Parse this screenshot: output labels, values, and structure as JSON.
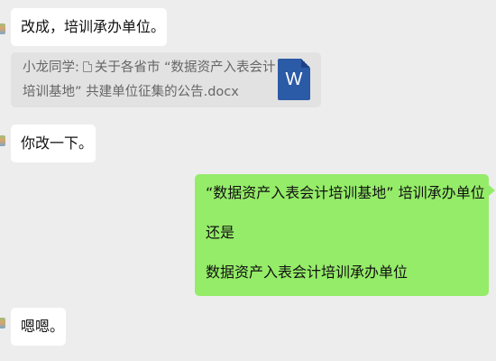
{
  "messages": {
    "m1": {
      "text": "改成，培训承办单位。"
    },
    "quote": {
      "line1_prefix": "小龙同学:",
      "line1_rest": "关于各省市 “数据资产入表会计",
      "line2": "培训基地” 共建单位征集的公告.docx",
      "file_icon_letter": "W",
      "file_icon": "word-doc-icon"
    },
    "m2": {
      "text": "你改一下。"
    },
    "m3": {
      "line1": "“数据资产入表会计培训基地” 培训承办单位",
      "line2": "还是",
      "line3": "数据资产入表会计培训承办单位"
    },
    "m4": {
      "text": "嗯嗯。"
    }
  },
  "colors": {
    "chat_bg": "#ededed",
    "incoming_bubble": "#ffffff",
    "outgoing_bubble": "#95ec69",
    "quote_bg": "#e2e2e2",
    "quote_text": "#666666",
    "word_blue": "#2b5aa6"
  }
}
